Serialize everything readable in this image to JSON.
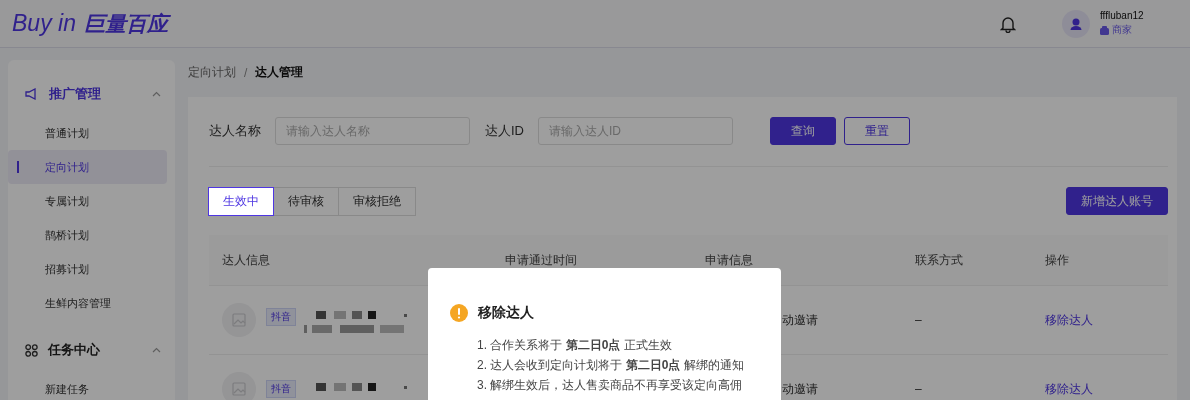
{
  "header": {
    "logo_latin": "Buy in",
    "logo_cjk": "巨量百应",
    "user": {
      "name": "fffluban12",
      "role": "商家"
    }
  },
  "sidebar": {
    "groups": [
      {
        "label": "推广管理",
        "kind": "megaphone",
        "expanded": true,
        "items": [
          {
            "label": "普通计划",
            "selected": false
          },
          {
            "label": "定向计划",
            "selected": true
          },
          {
            "label": "专属计划",
            "selected": false
          },
          {
            "label": "鹊桥计划",
            "selected": false
          },
          {
            "label": "招募计划",
            "selected": false
          },
          {
            "label": "生鲜内容管理",
            "selected": false
          }
        ]
      },
      {
        "label": "任务中心",
        "kind": "grid",
        "expanded": true,
        "items": [
          {
            "label": "新建任务",
            "selected": false
          }
        ]
      }
    ]
  },
  "breadcrumb": [
    "定向计划",
    "达人管理"
  ],
  "breadcrumb_separator": "/",
  "filters": [
    {
      "label": "达人名称",
      "placeholder": "请输入达人名称"
    },
    {
      "label": "达人ID",
      "placeholder": "请输入达人ID"
    }
  ],
  "filter_buttons": [
    {
      "label": "查询",
      "kind": "primary"
    },
    {
      "label": "重置",
      "kind": "secondary"
    }
  ],
  "tabs": [
    {
      "label": "生效中",
      "selected": true
    },
    {
      "label": "待审核",
      "selected": false
    },
    {
      "label": "审核拒绝",
      "selected": false
    }
  ],
  "add_button": "新增达人账号",
  "table": {
    "columns": [
      "达人信息",
      "申请通过时间",
      "申请信息",
      "联系方式",
      "操作"
    ],
    "rows": [
      {
        "platform": "抖音",
        "apply_info": "动邀请",
        "contact": "–",
        "action": "移除达人"
      },
      {
        "platform": "抖音",
        "apply_info": "动邀请",
        "contact": "–",
        "action": "移除达人"
      }
    ]
  },
  "modal": {
    "title": "移除达人",
    "lines": [
      "1. 合作关系将于 **第二日0点** 正式生效",
      "2. 达人会收到定向计划将于 **第二日0点** 解绑的通知",
      "3. 解绑生效后，达人售卖商品不再享受该定向高佣"
    ]
  }
}
